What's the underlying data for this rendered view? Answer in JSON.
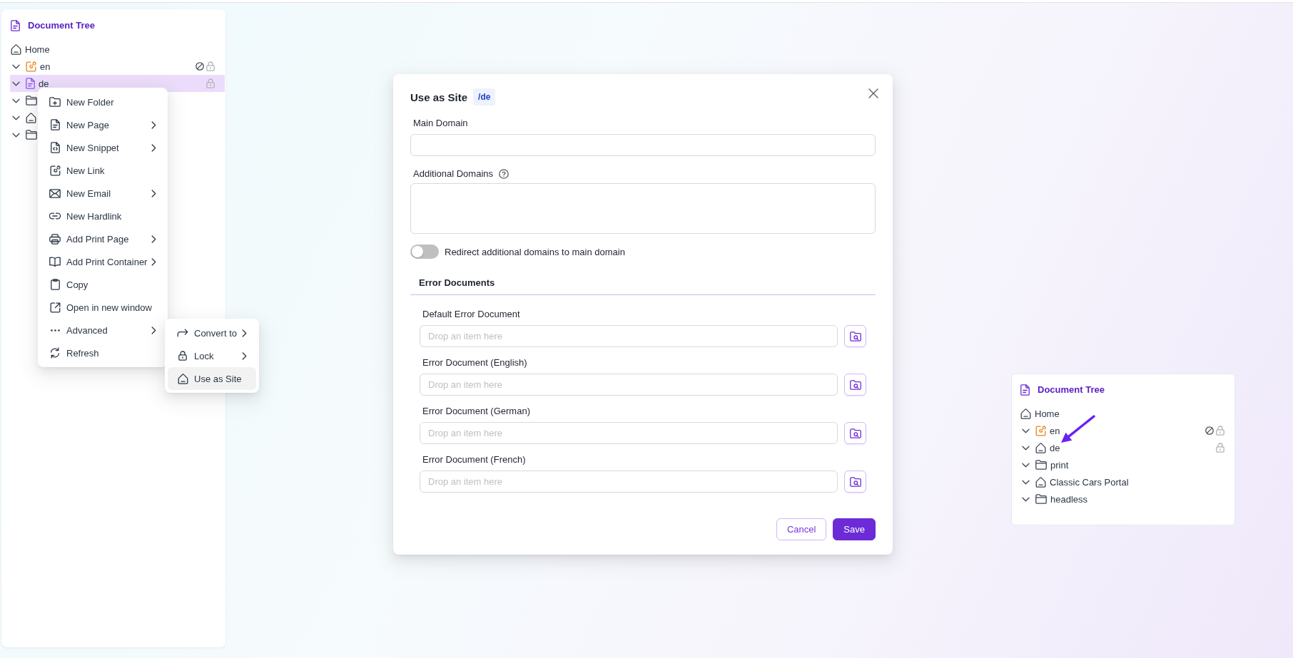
{
  "document_tree": {
    "title": "Document Tree",
    "root": {
      "kind": "site",
      "label": "Home",
      "selected": false,
      "unpublished": false,
      "locked": false,
      "children": [
        {
          "kind": "link",
          "label": "en",
          "selected": false,
          "unpublished": true,
          "locked": true
        },
        {
          "kind": "page",
          "label": "de",
          "selected": true,
          "unpublished": false,
          "locked": true
        },
        {
          "kind": "folder",
          "selected": false,
          "unpublished": false,
          "locked": false
        },
        {
          "kind": "site",
          "selected": false,
          "unpublished": false,
          "locked": false
        },
        {
          "kind": "folder",
          "selected": false,
          "unpublished": false,
          "locked": false
        }
      ]
    }
  },
  "context_menu": {
    "items": [
      {
        "label": "New Folder",
        "submenu": false,
        "selected": false
      },
      {
        "label": "New Page",
        "submenu": true,
        "selected": false
      },
      {
        "label": "New Snippet",
        "submenu": true,
        "selected": false
      },
      {
        "label": "New Link",
        "submenu": false,
        "selected": false
      },
      {
        "label": "New Email",
        "submenu": true,
        "selected": false
      },
      {
        "label": "New Hardlink",
        "submenu": false,
        "selected": false
      },
      {
        "label": "Add Print Page",
        "submenu": true,
        "selected": false
      },
      {
        "label": "Add Print Container",
        "submenu": true,
        "selected": false
      },
      {
        "label": "Copy",
        "submenu": false,
        "selected": false
      },
      {
        "label": "Open in new window",
        "submenu": false,
        "selected": false
      },
      {
        "label": "Advanced",
        "submenu": true,
        "selected": false
      },
      {
        "label": "Refresh",
        "submenu": false,
        "selected": false
      }
    ]
  },
  "submenu": {
    "items": [
      {
        "label": "Convert to",
        "submenu": true,
        "selected": false
      },
      {
        "label": "Lock",
        "submenu": true,
        "selected": false
      },
      {
        "label": "Use as Site",
        "submenu": false,
        "selected": true
      }
    ]
  },
  "dialog": {
    "title": "Use as Site",
    "path": "/de",
    "fields": [
      {
        "kind": "input",
        "label": "Main Domain"
      },
      {
        "kind": "textarea",
        "label": "Additional Domains",
        "help": true
      }
    ],
    "toggle": {
      "label": "Redirect additional domains to main domain",
      "on": false
    },
    "tabs": [
      {
        "label": "Error Documents",
        "selected": true
      }
    ],
    "error_documents": [
      {
        "label": "Default Error Document",
        "placeholder": "Drop an item here"
      },
      {
        "label": "Error Document (English)",
        "placeholder": "Drop an item here"
      },
      {
        "label": "Error Document (German)",
        "placeholder": "Drop an item here"
      },
      {
        "label": "Error Document (French)",
        "placeholder": "Drop an item here"
      }
    ],
    "buttons": [
      {
        "kind": "cancel",
        "label": "Cancel"
      },
      {
        "kind": "save",
        "label": "Save"
      }
    ]
  },
  "annotated_tree": {
    "title": "Document Tree",
    "root": {
      "kind": "site",
      "label": "Home",
      "selected": false,
      "unpublished": false,
      "locked": false,
      "children": [
        {
          "kind": "link",
          "label": "en",
          "selected": false,
          "unpublished": true,
          "locked": true
        },
        {
          "kind": "site",
          "label": "de",
          "selected": false,
          "unpublished": false,
          "locked": true
        },
        {
          "kind": "folder",
          "label": "print",
          "selected": false,
          "unpublished": false,
          "locked": false
        },
        {
          "kind": "site",
          "label": "Classic Cars Portal",
          "selected": false,
          "unpublished": false,
          "locked": false
        },
        {
          "kind": "folder",
          "label": "headless",
          "selected": false,
          "unpublished": false,
          "locked": false
        }
      ]
    }
  }
}
